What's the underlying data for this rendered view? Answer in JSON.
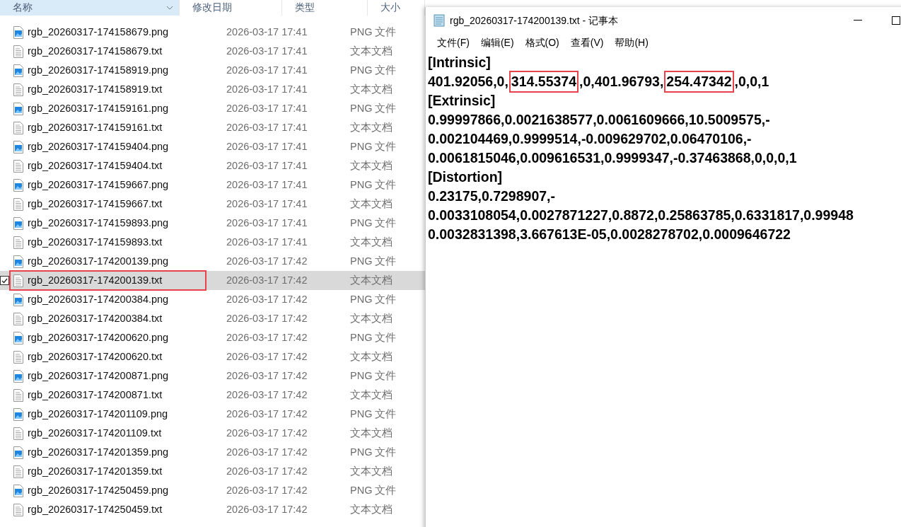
{
  "explorer": {
    "columns": [
      {
        "label": "名称",
        "sorted": true
      },
      {
        "label": "修改日期",
        "sorted": false
      },
      {
        "label": "类型",
        "sorted": false
      },
      {
        "label": "大小",
        "sorted": false
      }
    ],
    "rows": [
      {
        "kind": "png",
        "name": "rgb_20260317-174158679.png",
        "date": "2026-03-17 17:41",
        "type": "PNG 文件",
        "selected": false
      },
      {
        "kind": "txt",
        "name": "rgb_20260317-174158679.txt",
        "date": "2026-03-17 17:41",
        "type": "文本文档",
        "selected": false
      },
      {
        "kind": "png",
        "name": "rgb_20260317-174158919.png",
        "date": "2026-03-17 17:41",
        "type": "PNG 文件",
        "selected": false
      },
      {
        "kind": "txt",
        "name": "rgb_20260317-174158919.txt",
        "date": "2026-03-17 17:41",
        "type": "文本文档",
        "selected": false
      },
      {
        "kind": "png",
        "name": "rgb_20260317-174159161.png",
        "date": "2026-03-17 17:41",
        "type": "PNG 文件",
        "selected": false
      },
      {
        "kind": "txt",
        "name": "rgb_20260317-174159161.txt",
        "date": "2026-03-17 17:41",
        "type": "文本文档",
        "selected": false
      },
      {
        "kind": "png",
        "name": "rgb_20260317-174159404.png",
        "date": "2026-03-17 17:41",
        "type": "PNG 文件",
        "selected": false
      },
      {
        "kind": "txt",
        "name": "rgb_20260317-174159404.txt",
        "date": "2026-03-17 17:41",
        "type": "文本文档",
        "selected": false
      },
      {
        "kind": "png",
        "name": "rgb_20260317-174159667.png",
        "date": "2026-03-17 17:41",
        "type": "PNG 文件",
        "selected": false
      },
      {
        "kind": "txt",
        "name": "rgb_20260317-174159667.txt",
        "date": "2026-03-17 17:41",
        "type": "文本文档",
        "selected": false
      },
      {
        "kind": "png",
        "name": "rgb_20260317-174159893.png",
        "date": "2026-03-17 17:41",
        "type": "PNG 文件",
        "selected": false
      },
      {
        "kind": "txt",
        "name": "rgb_20260317-174159893.txt",
        "date": "2026-03-17 17:41",
        "type": "文本文档",
        "selected": false
      },
      {
        "kind": "png",
        "name": "rgb_20260317-174200139.png",
        "date": "2026-03-17 17:42",
        "type": "PNG 文件",
        "selected": false
      },
      {
        "kind": "txt",
        "name": "rgb_20260317-174200139.txt",
        "date": "2026-03-17 17:42",
        "type": "文本文档",
        "selected": true
      },
      {
        "kind": "png",
        "name": "rgb_20260317-174200384.png",
        "date": "2026-03-17 17:42",
        "type": "PNG 文件",
        "selected": false
      },
      {
        "kind": "txt",
        "name": "rgb_20260317-174200384.txt",
        "date": "2026-03-17 17:42",
        "type": "文本文档",
        "selected": false
      },
      {
        "kind": "png",
        "name": "rgb_20260317-174200620.png",
        "date": "2026-03-17 17:42",
        "type": "PNG 文件",
        "selected": false
      },
      {
        "kind": "txt",
        "name": "rgb_20260317-174200620.txt",
        "date": "2026-03-17 17:42",
        "type": "文本文档",
        "selected": false
      },
      {
        "kind": "png",
        "name": "rgb_20260317-174200871.png",
        "date": "2026-03-17 17:42",
        "type": "PNG 文件",
        "selected": false
      },
      {
        "kind": "txt",
        "name": "rgb_20260317-174200871.txt",
        "date": "2026-03-17 17:42",
        "type": "文本文档",
        "selected": false
      },
      {
        "kind": "png",
        "name": "rgb_20260317-174201109.png",
        "date": "2026-03-17 17:42",
        "type": "PNG 文件",
        "selected": false
      },
      {
        "kind": "txt",
        "name": "rgb_20260317-174201109.txt",
        "date": "2026-03-17 17:42",
        "type": "文本文档",
        "selected": false
      },
      {
        "kind": "png",
        "name": "rgb_20260317-174201359.png",
        "date": "2026-03-17 17:42",
        "type": "PNG 文件",
        "selected": false
      },
      {
        "kind": "txt",
        "name": "rgb_20260317-174201359.txt",
        "date": "2026-03-17 17:42",
        "type": "文本文档",
        "selected": false
      },
      {
        "kind": "png",
        "name": "rgb_20260317-174250459.png",
        "date": "2026-03-17 17:42",
        "type": "PNG 文件",
        "selected": false
      },
      {
        "kind": "txt",
        "name": "rgb_20260317-174250459.txt",
        "date": "2026-03-17 17:42",
        "type": "文本文档",
        "selected": false
      }
    ]
  },
  "notepad": {
    "title": "rgb_20260317-174200139.txt - 记事本",
    "menu": [
      "文件(F)",
      "编辑(E)",
      "格式(O)",
      "查看(V)",
      "帮助(H)"
    ],
    "lines": [
      [
        {
          "text": "[Intrinsic]",
          "highlighted": false
        }
      ],
      [
        {
          "text": "401.92056,0,",
          "highlighted": false
        },
        {
          "text": "314.55374",
          "highlighted": true
        },
        {
          "text": ",0,401.96793,",
          "highlighted": false
        },
        {
          "text": "254.47342",
          "highlighted": true
        },
        {
          "text": ",0,0,1",
          "highlighted": false
        }
      ],
      [
        {
          "text": "[Extrinsic]",
          "highlighted": false
        }
      ],
      [
        {
          "text": "0.99997866,0.0021638577,0.0061609666,10.5009575,-",
          "highlighted": false
        }
      ],
      [
        {
          "text": "0.002104469,0.9999514,-0.009629702,0.06470106,-",
          "highlighted": false
        }
      ],
      [
        {
          "text": "0.0061815046,0.009616531,0.9999347,-0.37463868,0,0,0,1",
          "highlighted": false
        }
      ],
      [
        {
          "text": "[Distortion]",
          "highlighted": false
        }
      ],
      [
        {
          "text": "0.23175,0.7298907,-",
          "highlighted": false
        }
      ],
      [
        {
          "text": "0.0033108054,0.0027871227,0.8872,0.25863785,0.6331817,0.99948",
          "highlighted": false
        }
      ],
      [
        {
          "text": "0.0032831398,3.667613E-05,0.0028278702,0.0009646722",
          "highlighted": false
        }
      ]
    ]
  }
}
